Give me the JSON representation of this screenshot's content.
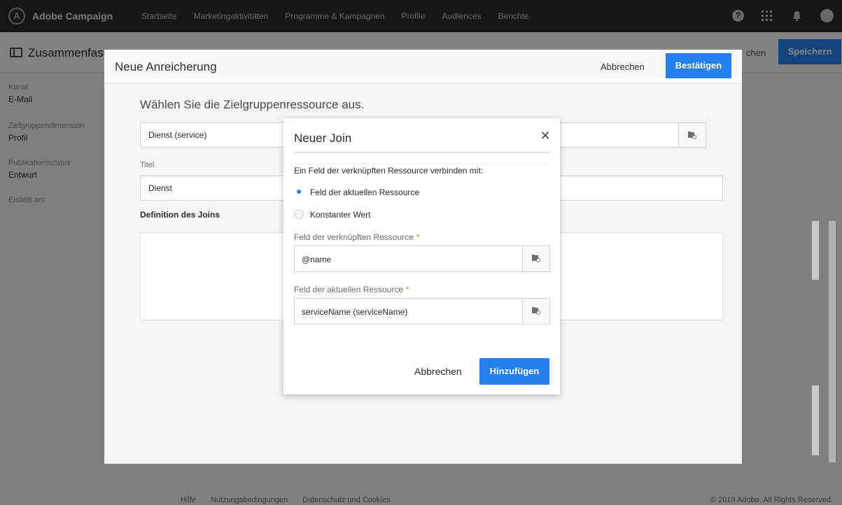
{
  "app": {
    "brand": "Adobe Campaign",
    "logo_glyph": "A"
  },
  "nav": [
    "Startseite",
    "Marketingaktivitäten",
    "Programme & Kampagnen",
    "Profile",
    "Audiences",
    "Berichte"
  ],
  "page": {
    "title": "Zusammenfass",
    "partial_link": "chen",
    "save_label": "Speichern",
    "meta": [
      {
        "label": "Kanal",
        "value": "E-Mail"
      },
      {
        "label": "Zielgruppendimension",
        "value": "Profil"
      },
      {
        "label": "Publikationsstatus",
        "value": "Entwurf"
      },
      {
        "label": "Erstellt am",
        "value": ""
      }
    ],
    "footer": [
      "Hilfe",
      "Nutzungsbedingungen",
      "Datenschutz und Cookies"
    ],
    "copyright": "© 2019 Adobe. All Rights Reserved."
  },
  "enrichment": {
    "title": "Neue Anreicherung",
    "cancel_label": "Abbrechen",
    "confirm_label": "Bestätigen",
    "subtitle": "Wählen Sie die Zielgruppenressource aus.",
    "resource_value": "Dienst (service)",
    "title_label": "Titel",
    "title_value": "Dienst",
    "join_definition_label": "Definition des Joins"
  },
  "join_modal": {
    "title": "Neuer Join",
    "intro": "Ein Feld der verknüpften Ressource verbinden mit:",
    "options": [
      {
        "label": "Feld der aktuellen Ressource",
        "selected": true
      },
      {
        "label": "Konstanter Wert",
        "selected": false
      }
    ],
    "linked_field_label": "Feld der verknüpften Ressource",
    "linked_field_value": "@name",
    "current_field_label": "Feld der aktuellen Ressource",
    "current_field_value": "serviceName (serviceName)",
    "required_mark": "*",
    "cancel_label": "Abbrechen",
    "add_label": "Hinzufügen"
  },
  "colors": {
    "accent": "#2680eb",
    "topbar": "#2c2c2c",
    "required": "#e68619"
  }
}
